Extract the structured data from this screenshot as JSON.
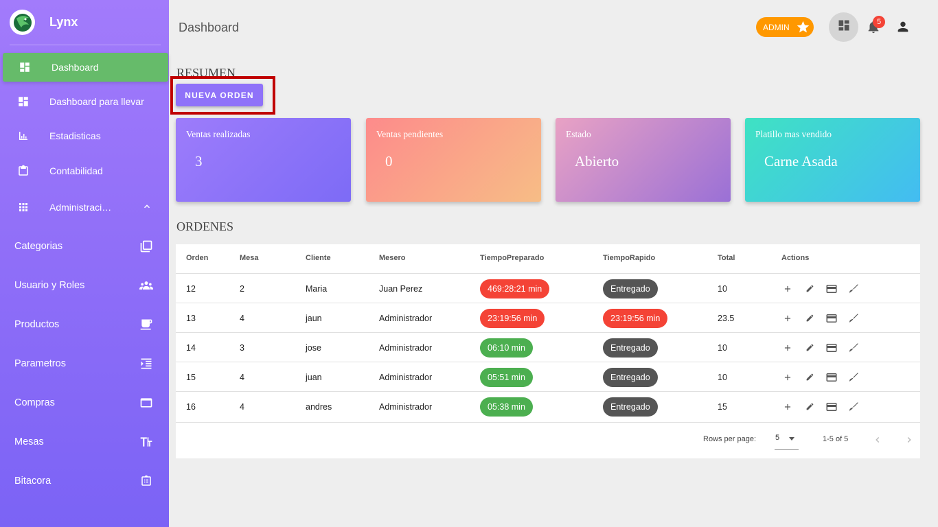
{
  "app": {
    "name": "Lynx"
  },
  "sidebar": {
    "main_items": [
      {
        "label": "Dashboard",
        "icon": "dashboard-icon"
      },
      {
        "label": "Dashboard para llevar",
        "icon": "dashboard-icon"
      },
      {
        "label": "Estadisticas",
        "icon": "bar-chart-icon"
      },
      {
        "label": "Contabilidad",
        "icon": "clipboard-icon"
      },
      {
        "label": "Administraci…",
        "icon": "apps-grid-icon"
      }
    ],
    "sub_items": [
      {
        "label": "Categorias",
        "icon": "library-icon"
      },
      {
        "label": "Usuario y Roles",
        "icon": "people-icon"
      },
      {
        "label": "Productos",
        "icon": "coffee-icon"
      },
      {
        "label": "Parametros",
        "icon": "format-indent-icon"
      },
      {
        "label": "Compras",
        "icon": "window-icon"
      },
      {
        "label": "Mesas",
        "icon": "text-height-icon"
      },
      {
        "label": "Bitacora",
        "icon": "assignment-icon"
      }
    ]
  },
  "header": {
    "title": "Dashboard",
    "role_chip": "ADMIN",
    "notifications_count": "5"
  },
  "resumen": {
    "title": "RESUMEN",
    "new_order_label": "NUEVA ORDEN",
    "cards": [
      {
        "label": "Ventas realizadas",
        "value": "3"
      },
      {
        "label": "Ventas pendientes",
        "value": "0"
      },
      {
        "label": "Estado",
        "value": "Abierto"
      },
      {
        "label": "Platillo mas vendido",
        "value": "Carne Asada"
      }
    ]
  },
  "ordenes": {
    "title": "ORDENES",
    "headers": [
      "Orden",
      "Mesa",
      "Cliente",
      "Mesero",
      "TiempoPreparado",
      "TiempoRapido",
      "Total",
      "Actions"
    ],
    "rows": [
      {
        "orden": "12",
        "mesa": "2",
        "cliente": "Maria",
        "mesero": "Juan Perez",
        "tiempo_preparado": "469:28:21 min",
        "tiempo_preparado_color": "#f44336",
        "tiempo_rapido": "Entregado",
        "tiempo_rapido_color": "#555555",
        "total": "10"
      },
      {
        "orden": "13",
        "mesa": "4",
        "cliente": "jaun",
        "mesero": "Administrador",
        "tiempo_preparado": "23:19:56 min",
        "tiempo_preparado_color": "#f44336",
        "tiempo_rapido": "23:19:56 min",
        "tiempo_rapido_color": "#f44336",
        "total": "23.5"
      },
      {
        "orden": "14",
        "mesa": "3",
        "cliente": "jose",
        "mesero": "Administrador",
        "tiempo_preparado": "06:10 min",
        "tiempo_preparado_color": "#4caf50",
        "tiempo_rapido": "Entregado",
        "tiempo_rapido_color": "#555555",
        "total": "10"
      },
      {
        "orden": "15",
        "mesa": "4",
        "cliente": "juan",
        "mesero": "Administrador",
        "tiempo_preparado": "05:51 min",
        "tiempo_preparado_color": "#4caf50",
        "tiempo_rapido": "Entregado",
        "tiempo_rapido_color": "#555555",
        "total": "10"
      },
      {
        "orden": "16",
        "mesa": "4",
        "cliente": "andres",
        "mesero": "Administrador",
        "tiempo_preparado": "05:38 min",
        "tiempo_preparado_color": "#4caf50",
        "tiempo_rapido": "Entregado",
        "tiempo_rapido_color": "#555555",
        "total": "15"
      }
    ],
    "footer": {
      "rows_per_page_label": "Rows per page:",
      "rows_per_page_value": "5",
      "range": "1-5 of 5"
    }
  },
  "colors": {
    "active_nav": "#66bb6a",
    "admin_chip": "#ff9800",
    "badge": "#f44336",
    "primary_button": "#8f72f9",
    "highlight_border": "#c00000"
  }
}
